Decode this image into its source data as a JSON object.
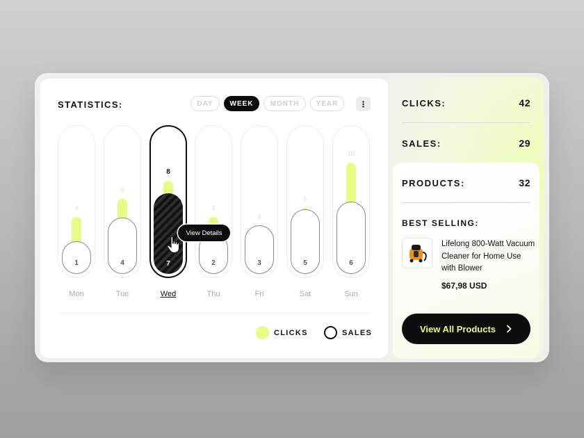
{
  "colors": {
    "accent": "#e8fb87",
    "dark": "#0d0d0d",
    "muted": "#a9a9a9"
  },
  "stats": {
    "title": "STATISTICS:",
    "tabs": [
      {
        "label": "DAY",
        "active": false
      },
      {
        "label": "WEEK",
        "active": true
      },
      {
        "label": "MONTH",
        "active": false
      },
      {
        "label": "YEAR",
        "active": false
      }
    ],
    "more_icon": "vertical-dots-icon",
    "more_glyph": "⋮",
    "days": [
      {
        "label": "Mon",
        "clicks": 4,
        "sales": 1,
        "selected": false
      },
      {
        "label": "Tue",
        "clicks": 6,
        "sales": 4,
        "selected": false
      },
      {
        "label": "Wed",
        "clicks": 8,
        "sales": 7,
        "selected": true
      },
      {
        "label": "Thu",
        "clicks": 4,
        "sales": 2,
        "selected": false
      },
      {
        "label": "Fri",
        "clicks": 3,
        "sales": 3,
        "selected": false
      },
      {
        "label": "Sat",
        "clicks": 5,
        "sales": 5,
        "selected": false
      },
      {
        "label": "Sun",
        "clicks": 10,
        "sales": 6,
        "selected": false
      }
    ],
    "tooltip": "View Details",
    "legend": {
      "clicks": "CLICKS",
      "sales": "SALES"
    }
  },
  "summary": {
    "clicks": {
      "label": "CLICKS:",
      "value": "42"
    },
    "sales": {
      "label": "SALES:",
      "value": "29"
    },
    "products": {
      "label": "PRODUCTS:",
      "value": "32"
    }
  },
  "best_selling": {
    "title": "BEST SELLING:",
    "product_name": "Lifelong 800-Watt Vacuum Cleaner for Home Use with Blower",
    "price": "$67,98 USD",
    "image_icon": "vacuum-cleaner-icon"
  },
  "cta": {
    "label": "View All Products",
    "icon": "chevron-right-icon"
  }
}
